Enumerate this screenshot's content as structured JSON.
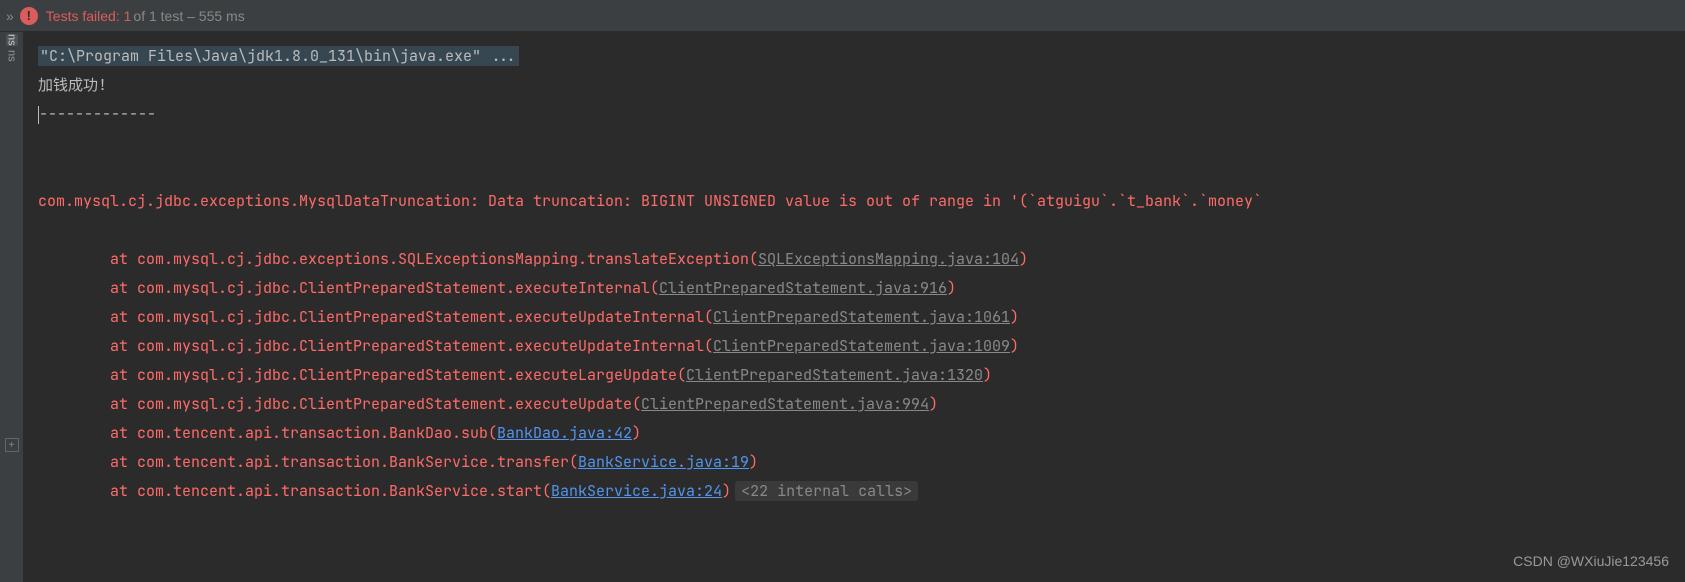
{
  "header": {
    "collapse_glyph": "»",
    "fail_glyph": "!",
    "fail_label": "Tests failed: 1",
    "count_label": " of 1 test – 555 ms"
  },
  "gutter": {
    "tab1": "ns",
    "tab2": "ns",
    "expand_glyph": "+"
  },
  "console": {
    "command": "\"C:\\Program Files\\Java\\jdk1.8.0_131\\bin\\java.exe\" ...",
    "line1": "加钱成功!",
    "line2": "-------------",
    "exception": "com.mysql.cj.jdbc.exceptions.MysqlDataTruncation: Data truncation: BIGINT UNSIGNED value is out of range in '(`atguigu`.`t_bank`.`money`",
    "stack": [
      {
        "prefix": "\tat com.mysql.cj.jdbc.exceptions.SQLExceptionsMapping.translateException(",
        "link": "SQLExceptionsMapping.java:104",
        "type": "gray",
        "suffix": ")"
      },
      {
        "prefix": "\tat com.mysql.cj.jdbc.ClientPreparedStatement.executeInternal(",
        "link": "ClientPreparedStatement.java:916",
        "type": "gray",
        "suffix": ")"
      },
      {
        "prefix": "\tat com.mysql.cj.jdbc.ClientPreparedStatement.executeUpdateInternal(",
        "link": "ClientPreparedStatement.java:1061",
        "type": "gray",
        "suffix": ")"
      },
      {
        "prefix": "\tat com.mysql.cj.jdbc.ClientPreparedStatement.executeUpdateInternal(",
        "link": "ClientPreparedStatement.java:1009",
        "type": "gray",
        "suffix": ")"
      },
      {
        "prefix": "\tat com.mysql.cj.jdbc.ClientPreparedStatement.executeLargeUpdate(",
        "link": "ClientPreparedStatement.java:1320",
        "type": "gray",
        "suffix": ")"
      },
      {
        "prefix": "\tat com.mysql.cj.jdbc.ClientPreparedStatement.executeUpdate(",
        "link": "ClientPreparedStatement.java:994",
        "type": "gray",
        "suffix": ")"
      },
      {
        "prefix": "\tat com.tencent.api.transaction.BankDao.sub(",
        "link": "BankDao.java:42",
        "type": "blue",
        "suffix": ")"
      },
      {
        "prefix": "\tat com.tencent.api.transaction.BankService.transfer(",
        "link": "BankService.java:19",
        "type": "blue",
        "suffix": ")"
      },
      {
        "prefix": "\tat com.tencent.api.transaction.BankService.start(",
        "link": "BankService.java:24",
        "type": "blue",
        "suffix": ")",
        "folded": "<22 internal calls>"
      }
    ],
    "watermark": "CSDN @WXiuJie123456"
  }
}
